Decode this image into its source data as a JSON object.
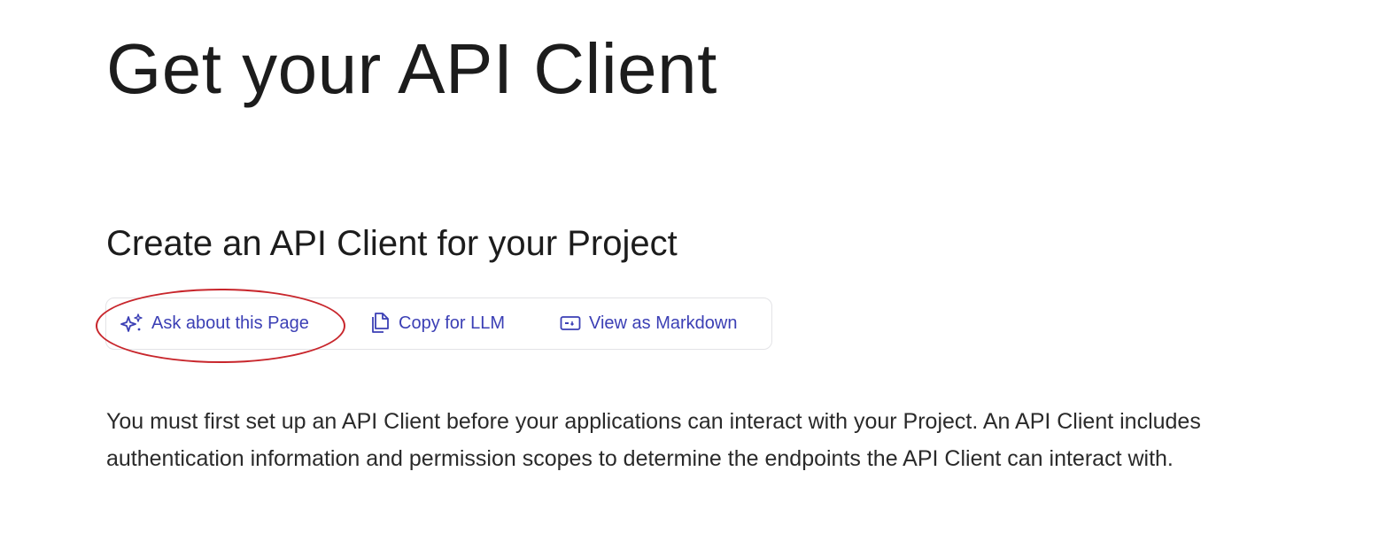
{
  "page": {
    "title": "Get your API Client"
  },
  "section": {
    "title": "Create an API Client for your Project"
  },
  "actions": {
    "ask": {
      "label": "Ask about this Page",
      "icon": "sparkle-icon"
    },
    "copy": {
      "label": "Copy for LLM",
      "icon": "copy-icon"
    },
    "markdown": {
      "label": "View as Markdown",
      "icon": "markdown-icon"
    }
  },
  "content": {
    "description": "You must first set up an API Client before your applications can interact with your Project. An API Client includes authentication information and permission scopes to determine the endpoints the API Client can interact with."
  },
  "colors": {
    "accent": "#3b3fb5",
    "highlight": "#c8262c",
    "border": "#e3e3e6",
    "text": "#1c1c1c"
  }
}
